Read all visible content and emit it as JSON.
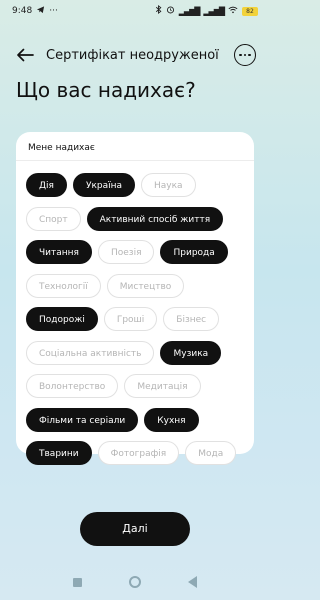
{
  "status": {
    "time": "9:48",
    "battery": "82"
  },
  "header": {
    "title": "Сертифікат неодруженої"
  },
  "page": {
    "title": "Що вас надихає?"
  },
  "card": {
    "label": "Мене надихає",
    "chips": [
      {
        "label": "Дія",
        "selected": true
      },
      {
        "label": "Україна",
        "selected": true
      },
      {
        "label": "Наука",
        "selected": false
      },
      {
        "label": "Спорт",
        "selected": false
      },
      {
        "label": "Активний спосіб життя",
        "selected": true
      },
      {
        "label": "Читання",
        "selected": true
      },
      {
        "label": "Поезія",
        "selected": false
      },
      {
        "label": "Природа",
        "selected": true
      },
      {
        "label": "Технології",
        "selected": false
      },
      {
        "label": "Мистецтво",
        "selected": false
      },
      {
        "label": "Подорожі",
        "selected": true
      },
      {
        "label": "Гроші",
        "selected": false
      },
      {
        "label": "Бізнес",
        "selected": false
      },
      {
        "label": "Соціальна активність",
        "selected": false
      },
      {
        "label": "Музика",
        "selected": true
      },
      {
        "label": "Волонтерство",
        "selected": false
      },
      {
        "label": "Медитація",
        "selected": false
      },
      {
        "label": "Фільми та серіали",
        "selected": true
      },
      {
        "label": "Кухня",
        "selected": true
      },
      {
        "label": "Тварини",
        "selected": true
      },
      {
        "label": "Фотографія",
        "selected": false
      },
      {
        "label": "Мода",
        "selected": false
      }
    ]
  },
  "footer": {
    "next_label": "Далі"
  },
  "colors": {
    "accent": "#111111",
    "chip_unselected_text": "#b5b5b5",
    "chip_border": "#e1e1e1"
  }
}
